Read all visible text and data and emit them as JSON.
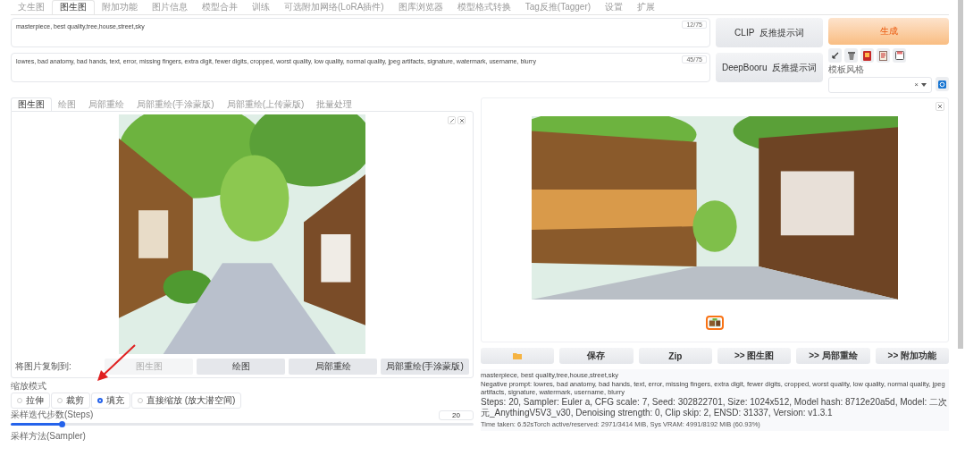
{
  "top_tabs": [
    {
      "label": "文生图",
      "selected": false
    },
    {
      "label": "图生图",
      "selected": true
    },
    {
      "label": "附加功能",
      "selected": false
    },
    {
      "label": "图片信息",
      "selected": false
    },
    {
      "label": "模型合并",
      "selected": false
    },
    {
      "label": "训练",
      "selected": false
    },
    {
      "label": "可选附加网络(LoRA插件)",
      "selected": false
    },
    {
      "label": "图库浏览器",
      "selected": false
    },
    {
      "label": "模型格式转换",
      "selected": false
    },
    {
      "label": "Tag反推(Tagger)",
      "selected": false
    },
    {
      "label": "设置",
      "selected": false
    },
    {
      "label": "扩展",
      "selected": false
    }
  ],
  "prompt": {
    "value": "masterpiece, best quality,tree,house,street,sky",
    "token_count": "12/75"
  },
  "negative_prompt": {
    "value": "lowres, bad anatomy, bad hands, text, error, missing fingers, extra digit, fewer digits, cropped, worst quality, low quality, normal quality, jpeg artifacts, signature, watermark, username, blurry",
    "token_count": "45/75"
  },
  "interrogate_buttons": [
    {
      "prefix": "CLIP",
      "label": "反推提示词"
    },
    {
      "prefix": "DeepBooru",
      "label": "反推提示词"
    }
  ],
  "generate_button": {
    "label": "生成"
  },
  "style_dropdown": {
    "label": "模板风格",
    "clear_glyph": "×"
  },
  "img2img_tabs": [
    {
      "label": "图生图",
      "selected": true
    },
    {
      "label": "绘图",
      "selected": false
    },
    {
      "label": "局部重绘",
      "selected": false
    },
    {
      "label": "局部重绘(手涂蒙版)",
      "selected": false
    },
    {
      "label": "局部重绘(上传蒙版)",
      "selected": false
    },
    {
      "label": "批量处理",
      "selected": false
    }
  ],
  "source_image": {
    "kind": "picture"
  },
  "copy_to": {
    "label": "将图片复制到:",
    "buttons": [
      {
        "label": "图生图",
        "disabled": true
      },
      {
        "label": "绘图",
        "disabled": false
      },
      {
        "label": "局部重绘",
        "disabled": false
      },
      {
        "label": "局部重绘(手涂蒙版)",
        "disabled": false
      }
    ]
  },
  "resize_mode": {
    "label": "缩放模式",
    "options": [
      {
        "label": "拉伸",
        "selected": false
      },
      {
        "label": "裁剪",
        "selected": false
      },
      {
        "label": "填充",
        "selected": true
      },
      {
        "label": "直接缩放 (放大潜空间)",
        "selected": false
      }
    ]
  },
  "steps": {
    "label": "采样迭代步数(Steps)",
    "value": "20",
    "level": 0.11
  },
  "sampler": {
    "label": "采样方法(Sampler)"
  },
  "output": {
    "image": {
      "kind": "picture"
    },
    "buttons": [
      {
        "kind": "folder"
      },
      {
        "kind": "text",
        "label": "保存"
      },
      {
        "kind": "text",
        "label": "Zip"
      },
      {
        "kind": "text",
        "label": ">> 图生图"
      },
      {
        "kind": "text",
        "label": ">> 局部重绘"
      },
      {
        "kind": "text",
        "label": ">> 附加功能"
      }
    ],
    "info": [
      "masterpiece, best quality,tree,house,street,sky",
      "Negative prompt: lowres, bad anatomy, bad hands, text, error, missing fingers, extra digit, fewer digits, cropped, worst quality, low quality, normal quality, jpeg artifacts, signature, watermark, username, blurry",
      "Steps: 20, Sampler: Euler a, CFG scale: 7, Seed: 302822701, Size: 1024x512, Model hash: 8712e20a5d, Model: 二次元_AnythingV5V3_v30, Denoising strength: 0, Clip skip: 2, ENSD: 31337, Version: v1.3.1"
    ],
    "time": "Time taken: 6.52sTorch active/reserved: 2971/3414 MiB, Sys VRAM: 4991/8192 MiB (60.93%)"
  }
}
